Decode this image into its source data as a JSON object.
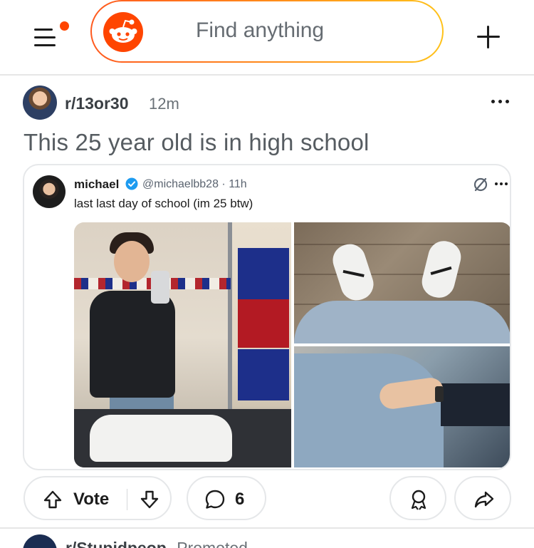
{
  "header": {
    "search_placeholder": "Find anything",
    "menu_has_notification": true,
    "accent_color": "#ff4500"
  },
  "post": {
    "subreddit": "r/13or30",
    "time": "12m",
    "title": "This 25 year old is in high school",
    "embed": {
      "author_name": "michael",
      "author_handle": "@michaelbb28 · 11h",
      "verified": true,
      "text": "last last day of school (im 25 btw)",
      "source_icon": "x-logo-icon",
      "photo_count": 3
    },
    "actions": {
      "vote_label": "Vote",
      "comment_count": "6"
    }
  },
  "next_post": {
    "subreddit_partial": "r/Stupidpeop",
    "label_partial": "Promoted"
  }
}
